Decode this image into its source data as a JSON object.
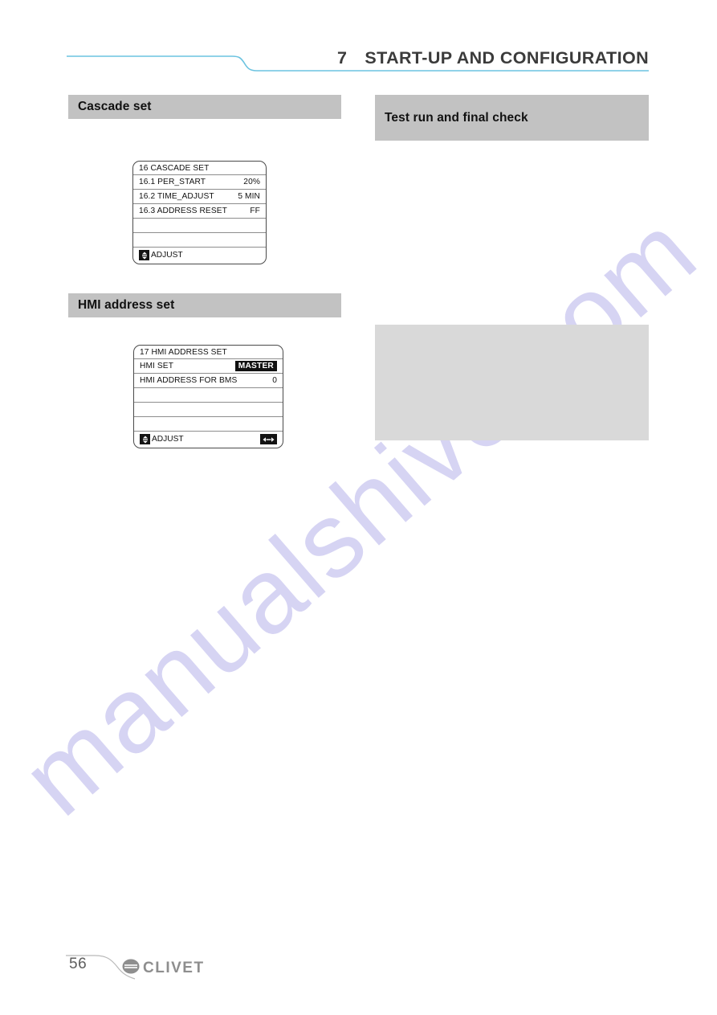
{
  "header": {
    "chapter_number": "7",
    "title": "START-UP AND CONFIGURATION",
    "rule_color": "#6cc3e0"
  },
  "watermark": {
    "text": "manualshive.com",
    "color": "#c9c6ef"
  },
  "left_column": {
    "section_cascade": {
      "heading": "Cascade set",
      "panel": {
        "title_row": {
          "label": "16 CASCADE SET",
          "value": ""
        },
        "rows": [
          {
            "label": "16.1 PER_START",
            "value": "20%"
          },
          {
            "label": "16.2 TIME_ADJUST",
            "value": "5 MIN"
          },
          {
            "label": "16.3 ADDRESS RESET",
            "value": "FF"
          },
          {
            "label": "",
            "value": ""
          },
          {
            "label": "",
            "value": ""
          }
        ],
        "footer": {
          "key_icon": "up-down-arrow-icon",
          "key_glyph": "↕",
          "label": "ADJUST",
          "right_icon": null,
          "right_glyph": null
        }
      }
    },
    "section_hmi": {
      "heading": "HMI address set",
      "panel": {
        "title_row": {
          "label": "17 HMI ADDRESS SET",
          "value": ""
        },
        "rows": [
          {
            "label": "HMI SET",
            "value": "MASTER",
            "highlight": true
          },
          {
            "label": "HMI ADDRESS FOR BMS",
            "value": "0"
          },
          {
            "label": "",
            "value": ""
          },
          {
            "label": "",
            "value": ""
          },
          {
            "label": "",
            "value": ""
          }
        ],
        "footer": {
          "key_icon": "up-down-arrow-icon",
          "key_glyph": "↕",
          "label": "ADJUST",
          "right_icon": "left-right-arrow-icon",
          "right_glyph": "◀▶"
        }
      }
    }
  },
  "right_column": {
    "section_test_run": {
      "heading": "Test run and final check"
    },
    "content_placeholder": {
      "label": "",
      "color": "#d9d9d9"
    }
  },
  "footer": {
    "page_number": "56",
    "brand_name": "CLIVET",
    "brand_color": "#8e8e8e"
  }
}
